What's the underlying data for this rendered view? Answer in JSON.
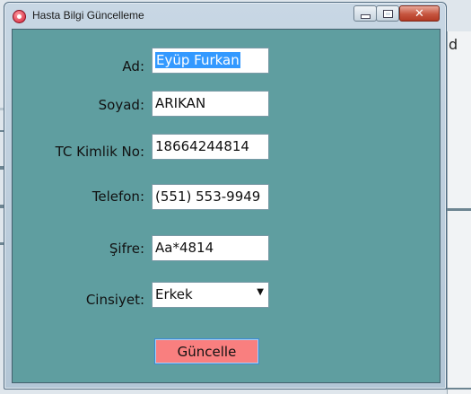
{
  "dialog": {
    "title": "Hasta Bilgi Güncelleme",
    "icon": "app-icon"
  },
  "background": {
    "partial_text": "d"
  },
  "form": {
    "ad_label": "Ad:",
    "ad_value": "Eyüp Furkan",
    "soyad_label": "Soyad:",
    "soyad_value": "ARIKAN",
    "tc_label": "TC Kimlik No:",
    "tc_value": "18664244814",
    "telefon_label": "Telefon:",
    "telefon_value": "(551) 553-9949",
    "sifre_label": "Şifre:",
    "sifre_value": "Aa*4814",
    "cinsiyet_label": "Cinsiyet:",
    "cinsiyet_value": "Erkek",
    "update_label": "Güncelle"
  },
  "colors": {
    "client_bg": "#5f9ea0",
    "button_bg": "#f97f7f",
    "selection": "#3399ff"
  }
}
